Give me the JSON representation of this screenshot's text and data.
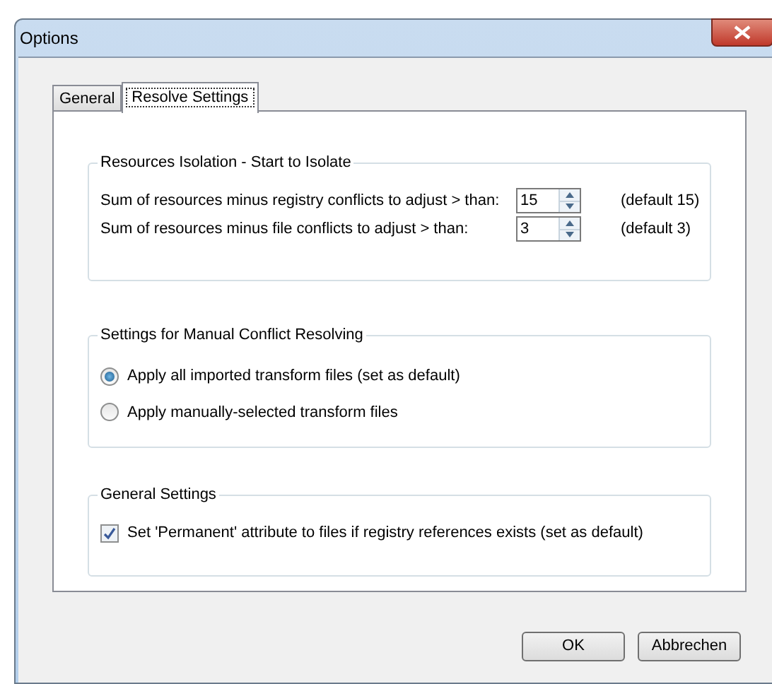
{
  "window": {
    "title": "Options"
  },
  "tabs": [
    {
      "label": "General",
      "selected": false
    },
    {
      "label": "Resolve Settings",
      "selected": true
    }
  ],
  "isolation": {
    "title": "Resources Isolation - Start to Isolate",
    "rows": [
      {
        "label": "Sum of resources minus registry conflicts to adjust > than:",
        "value": "15",
        "note": "(default 15)"
      },
      {
        "label": "Sum of resources minus file conflicts to adjust > than:",
        "value": "3",
        "note": "(default 3)"
      }
    ]
  },
  "manual": {
    "title": "Settings for Manual Conflict Resolving",
    "options": [
      {
        "label": "Apply all imported transform files  (set as default)",
        "selected": true
      },
      {
        "label": "Apply manually-selected transform files",
        "selected": false
      }
    ]
  },
  "general": {
    "title": "General Settings",
    "checks": [
      {
        "label": "Set 'Permanent' attribute to files if registry references exists  (set as default)",
        "checked": true
      }
    ]
  },
  "buttons": [
    "OK",
    "Abbrechen"
  ]
}
